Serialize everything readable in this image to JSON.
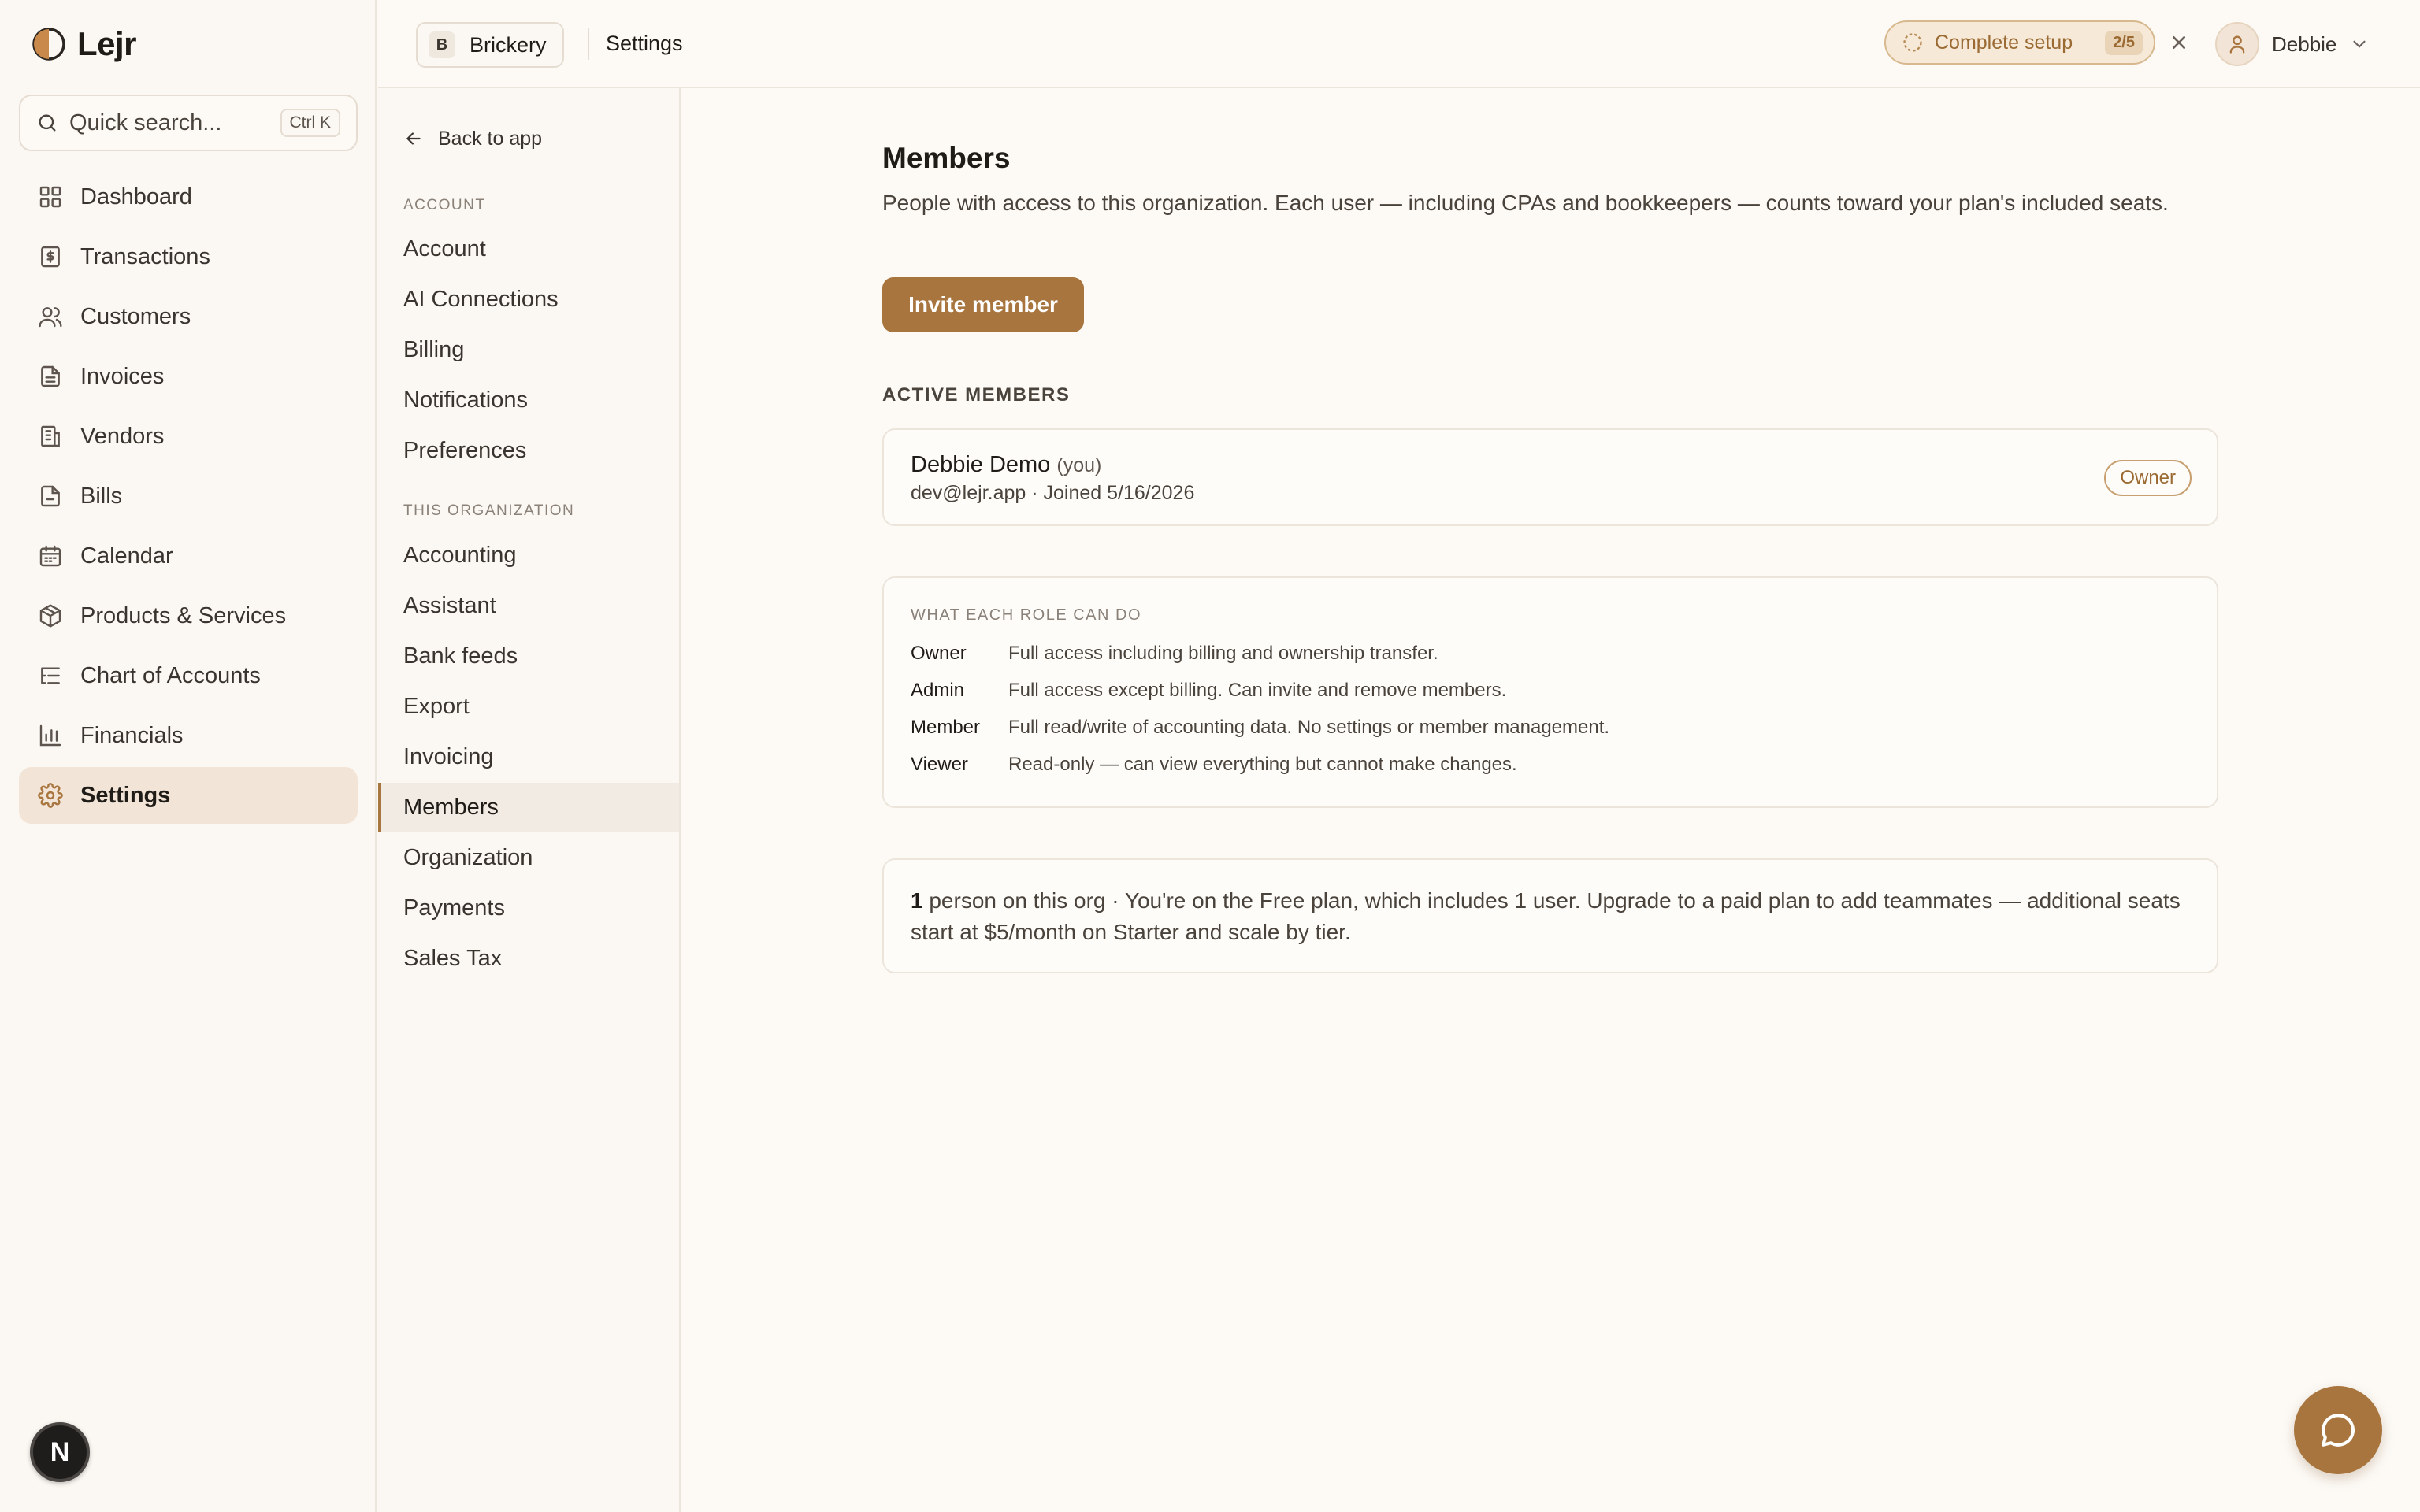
{
  "brand": {
    "name": "Lejr"
  },
  "search": {
    "placeholder": "Quick search...",
    "shortcut": "Ctrl K"
  },
  "nav": {
    "items": [
      {
        "label": "Dashboard",
        "icon": "grid-icon"
      },
      {
        "label": "Transactions",
        "icon": "receipt-dollar-icon"
      },
      {
        "label": "Customers",
        "icon": "users-icon"
      },
      {
        "label": "Invoices",
        "icon": "file-text-icon"
      },
      {
        "label": "Vendors",
        "icon": "building-icon"
      },
      {
        "label": "Bills",
        "icon": "file-icon"
      },
      {
        "label": "Calendar",
        "icon": "calendar-icon"
      },
      {
        "label": "Products & Services",
        "icon": "package-icon"
      },
      {
        "label": "Chart of Accounts",
        "icon": "list-tree-icon"
      },
      {
        "label": "Financials",
        "icon": "bar-chart-icon"
      },
      {
        "label": "Settings",
        "icon": "gear-icon",
        "active": true
      }
    ]
  },
  "badge": {
    "letter": "N"
  },
  "topbar": {
    "org_initial": "B",
    "org_name": "Brickery",
    "breadcrumb": "Settings",
    "setup_label": "Complete setup",
    "setup_count": "2/5",
    "user_name": "Debbie"
  },
  "subnav": {
    "back_label": "Back to app",
    "account_section": "ACCOUNT",
    "account_items": [
      "Account",
      "AI Connections",
      "Billing",
      "Notifications",
      "Preferences"
    ],
    "org_section": "THIS ORGANIZATION",
    "org_items": [
      "Accounting",
      "Assistant",
      "Bank feeds",
      "Export",
      "Invoicing",
      "Members",
      "Organization",
      "Payments",
      "Sales Tax"
    ],
    "active": "Members"
  },
  "main": {
    "title": "Members",
    "description": "People with access to this organization. Each user — including CPAs and bookkeepers — counts toward your plan's included seats.",
    "invite_label": "Invite member",
    "active_heading": "ACTIVE MEMBERS",
    "members": [
      {
        "name": "Debbie Demo",
        "you": "(you)",
        "meta": "dev@lejr.app · Joined 5/16/2026",
        "role": "Owner"
      }
    ],
    "roles_heading": "WHAT EACH ROLE CAN DO",
    "roles": [
      {
        "name": "Owner",
        "desc": "Full access including billing and ownership transfer."
      },
      {
        "name": "Admin",
        "desc": "Full access except billing. Can invite and remove members."
      },
      {
        "name": "Member",
        "desc": "Full read/write of accounting data. No settings or member management."
      },
      {
        "name": "Viewer",
        "desc": "Read-only — can view everything but cannot make changes."
      }
    ],
    "plan_count": "1",
    "plan_text": " person on this org · You're on the Free plan, which includes 1 user. Upgrade to a paid plan to add teammates — additional seats start at $5/month on Starter and scale by tier."
  },
  "colors": {
    "accent": "#a8753e",
    "background": "#fdfaf6",
    "sidebar": "#fbf7f2",
    "active_nav": "#f2e4d6"
  }
}
